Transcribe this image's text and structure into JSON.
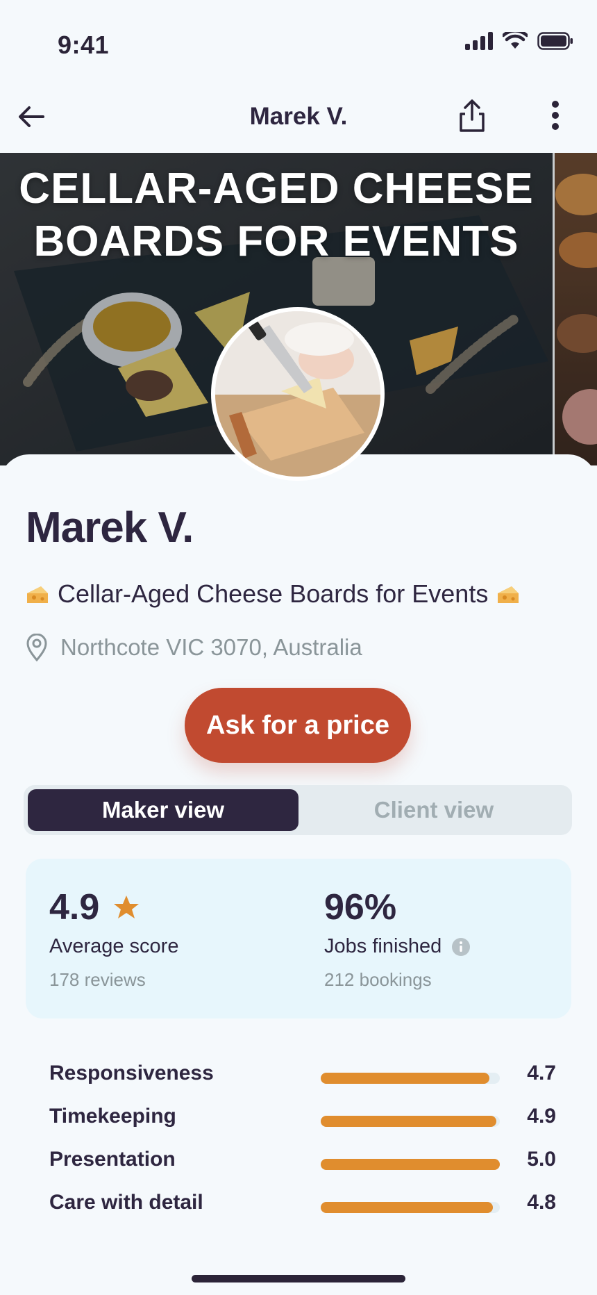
{
  "status_bar": {
    "time": "9:41"
  },
  "nav": {
    "title": "Marek V."
  },
  "hero": {
    "title": "CELLAR-AGED CHEESE BOARDS FOR EVENTS"
  },
  "profile": {
    "name": "Marek V.",
    "tagline": "Cellar-Aged Cheese Boards for Events",
    "location": "Northcote VIC 3070, Australia"
  },
  "cta": {
    "label": "Ask for a price"
  },
  "view_toggle": {
    "maker_label": "Maker view",
    "client_label": "Client view",
    "selected": "Maker view"
  },
  "stats": {
    "score": {
      "value": "4.9",
      "label": "Average score",
      "sub": "178 reviews"
    },
    "jobs": {
      "value": "96%",
      "label": "Jobs finished",
      "sub": "212 bookings"
    }
  },
  "ratings": [
    {
      "label": "Responsiveness",
      "value": "4.7",
      "fraction": 0.94
    },
    {
      "label": "Timekeeping",
      "value": "4.9",
      "fraction": 0.98
    },
    {
      "label": "Presentation",
      "value": "5.0",
      "fraction": 1.0
    },
    {
      "label": "Care with detail",
      "value": "4.8",
      "fraction": 0.96
    }
  ],
  "colors": {
    "accent": "#c14a30",
    "dark": "#2e2640",
    "rating_bar": "#e08d2e",
    "muted": "#8a9599"
  },
  "icons": [
    "back-arrow-icon",
    "share-icon",
    "more-vertical-icon",
    "cheese-icon",
    "location-pin-icon",
    "star-icon",
    "info-icon"
  ]
}
